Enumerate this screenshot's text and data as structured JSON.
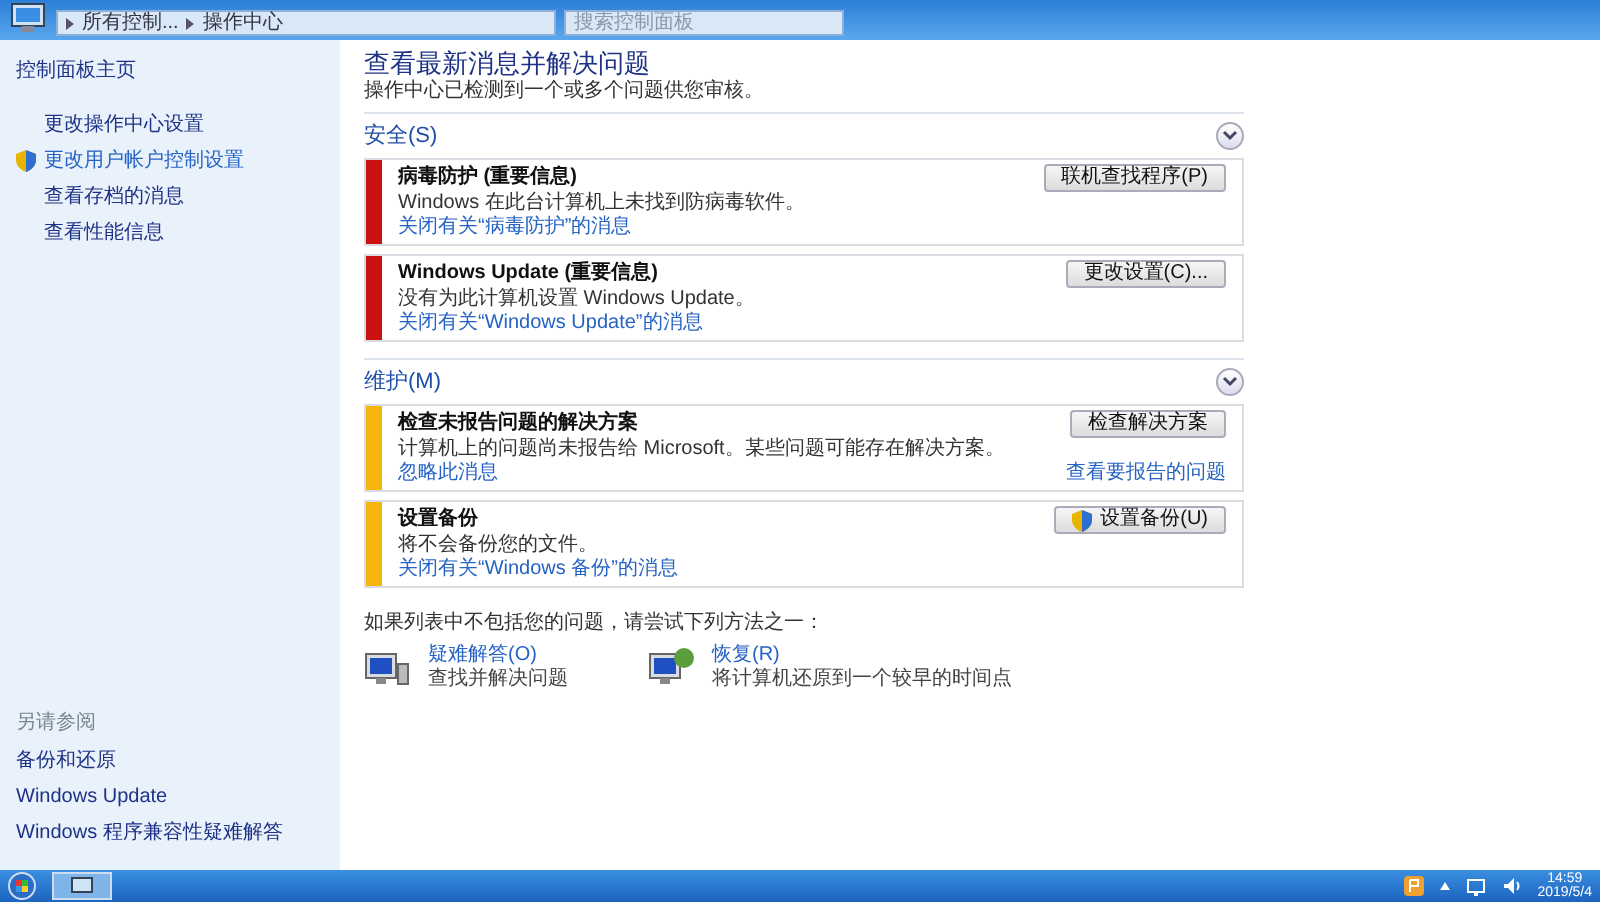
{
  "address_bar": {
    "breadcrumbs": [
      "所有控制...",
      "操作中心"
    ],
    "search": {
      "placeholder": "搜索控制面板"
    }
  },
  "sidebar": {
    "home": "控制面板主页",
    "items": [
      {
        "label": "更改操作中心设置",
        "shield": false
      },
      {
        "label": "更改用户帐户控制设置",
        "shield": true
      },
      {
        "label": "查看存档的消息",
        "shield": false
      },
      {
        "label": "查看性能信息",
        "shield": false
      }
    ],
    "see_also": {
      "title": "另请参阅",
      "links": [
        "备份和还原",
        "Windows Update",
        "Windows 程序兼容性疑难解答"
      ]
    }
  },
  "main": {
    "title": "查看最新消息并解决问题",
    "subtitle": "操作中心已检测到一个或多个问题供您审核。",
    "sections": [
      {
        "title": "安全(S)",
        "expanded": true,
        "messages": [
          {
            "title": "病毒防护 (重要信息)",
            "text": "Windows 在此台计算机上未找到防病毒软件。",
            "link": "关闭有关“病毒防护”的消息",
            "button": "联机查找程序(P)",
            "button_shield": false,
            "color": "#cc1111"
          },
          {
            "title": "Windows Update (重要信息)",
            "text": "没有为此计算机设置 Windows Update。",
            "link": "关闭有关“Windows Update”的消息",
            "button": "更改设置(C)...",
            "button_shield": false,
            "color": "#cc1111"
          }
        ]
      },
      {
        "title": "维护(M)",
        "expanded": true,
        "messages": [
          {
            "title": "检查未报告问题的解决方案",
            "text": "计算机上的问题尚未报告给 Microsoft。某些问题可能存在解决方案。",
            "link": "忽略此消息",
            "link_right": "查看要报告的问题",
            "button": "检查解决方案",
            "button_shield": false,
            "color": "#f5b50c"
          },
          {
            "title": "设置备份",
            "text": "将不会备份您的文件。",
            "link": "关闭有关“Windows 备份”的消息",
            "button": "设置备份(U)",
            "button_shield": true,
            "color": "#f5b50c"
          }
        ]
      }
    ],
    "hint": "如果列表中不包括您的问题，请尝试下列方法之一：",
    "tools": [
      {
        "title": "疑难解答(O)",
        "text": "查找并解决问题"
      },
      {
        "title": "恢复(R)",
        "text": "将计算机还原到一个较早的时间点"
      }
    ]
  },
  "taskbar": {
    "time": "14:59",
    "date": "2019/5/4"
  }
}
